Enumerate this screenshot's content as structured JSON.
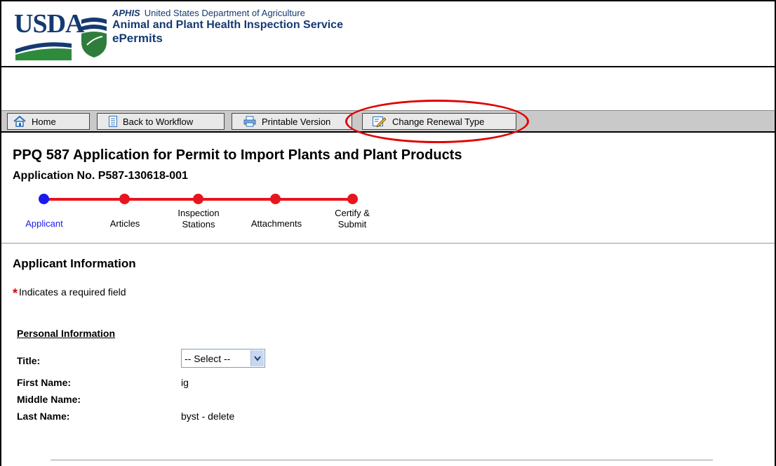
{
  "header": {
    "logo_text": "USDA",
    "aphis_abbr": "APHIS",
    "department": "United States Department of Agriculture",
    "agency": "Animal and Plant Health Inspection Service",
    "app_name": "ePermits"
  },
  "toolbar": {
    "home_label": "Home",
    "back_label": "Back to Workflow",
    "print_label": "Printable Version",
    "renewal_label": "Change Renewal Type",
    "highlight_color": "#e00000"
  },
  "page": {
    "title": "PPQ 587 Application for Permit to Import Plants and Plant Products",
    "application_number": "Application No. P587-130618-001"
  },
  "steps": [
    {
      "label": "Applicant",
      "active": true
    },
    {
      "label": "Articles",
      "active": false
    },
    {
      "label": "Inspection Stations",
      "active": false
    },
    {
      "label": "Attachments",
      "active": false
    },
    {
      "label": "Certify & Submit",
      "active": false
    }
  ],
  "section": {
    "title": "Applicant Information",
    "required_star": "*",
    "required_note": "Indicates a required field",
    "subsection": "Personal Information"
  },
  "fields": {
    "title_label": "Title:",
    "title_value": "-- Select --",
    "first_name_label": "First Name:",
    "first_name_value": "ig",
    "middle_name_label": "Middle Name:",
    "middle_name_value": "",
    "last_name_label": "Last Name:",
    "last_name_value": "byst - delete"
  },
  "colors": {
    "progress": "#e8141e",
    "active_step": "#1a1aee",
    "brand": "#153a70"
  }
}
